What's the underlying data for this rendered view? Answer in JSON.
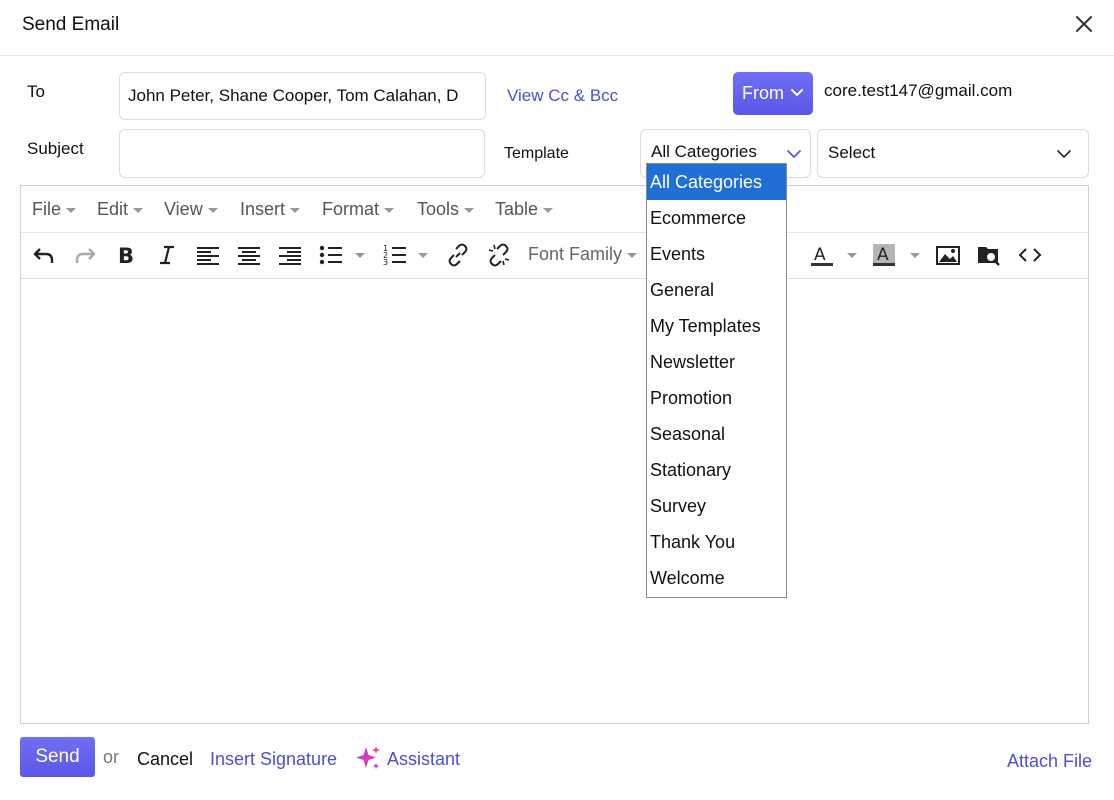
{
  "dialog": {
    "title": "Send Email"
  },
  "form": {
    "to_label": "To",
    "to_value": "John Peter, Shane Cooper, Tom Calahan, D",
    "view_cc_bcc": "View Cc & Bcc",
    "from_label": "From",
    "from_email": "core.test147@gmail.com",
    "subject_label": "Subject",
    "subject_value": "",
    "template_label": "Template",
    "category_selected": "All Categories",
    "template_selected": "Select"
  },
  "editor": {
    "menus": [
      "File",
      "Edit",
      "View",
      "Insert",
      "Format",
      "Tools",
      "Table"
    ],
    "font_family": "Font Family"
  },
  "dropdown": {
    "options": [
      "All Categories",
      "Ecommerce",
      "Events",
      "General",
      "My Templates",
      "Newsletter",
      "Promotion",
      "Seasonal",
      "Stationary",
      "Survey",
      "Thank You",
      "Welcome"
    ],
    "selected": "All Categories"
  },
  "footer": {
    "send": "Send",
    "or": "or",
    "cancel": "Cancel",
    "insert_signature": "Insert Signature",
    "assistant": "Assistant",
    "attach_file": "Attach File"
  },
  "colors": {
    "accent": "#5b56e8",
    "link": "#4b4fd1",
    "selected_option": "#1f6fd6"
  }
}
